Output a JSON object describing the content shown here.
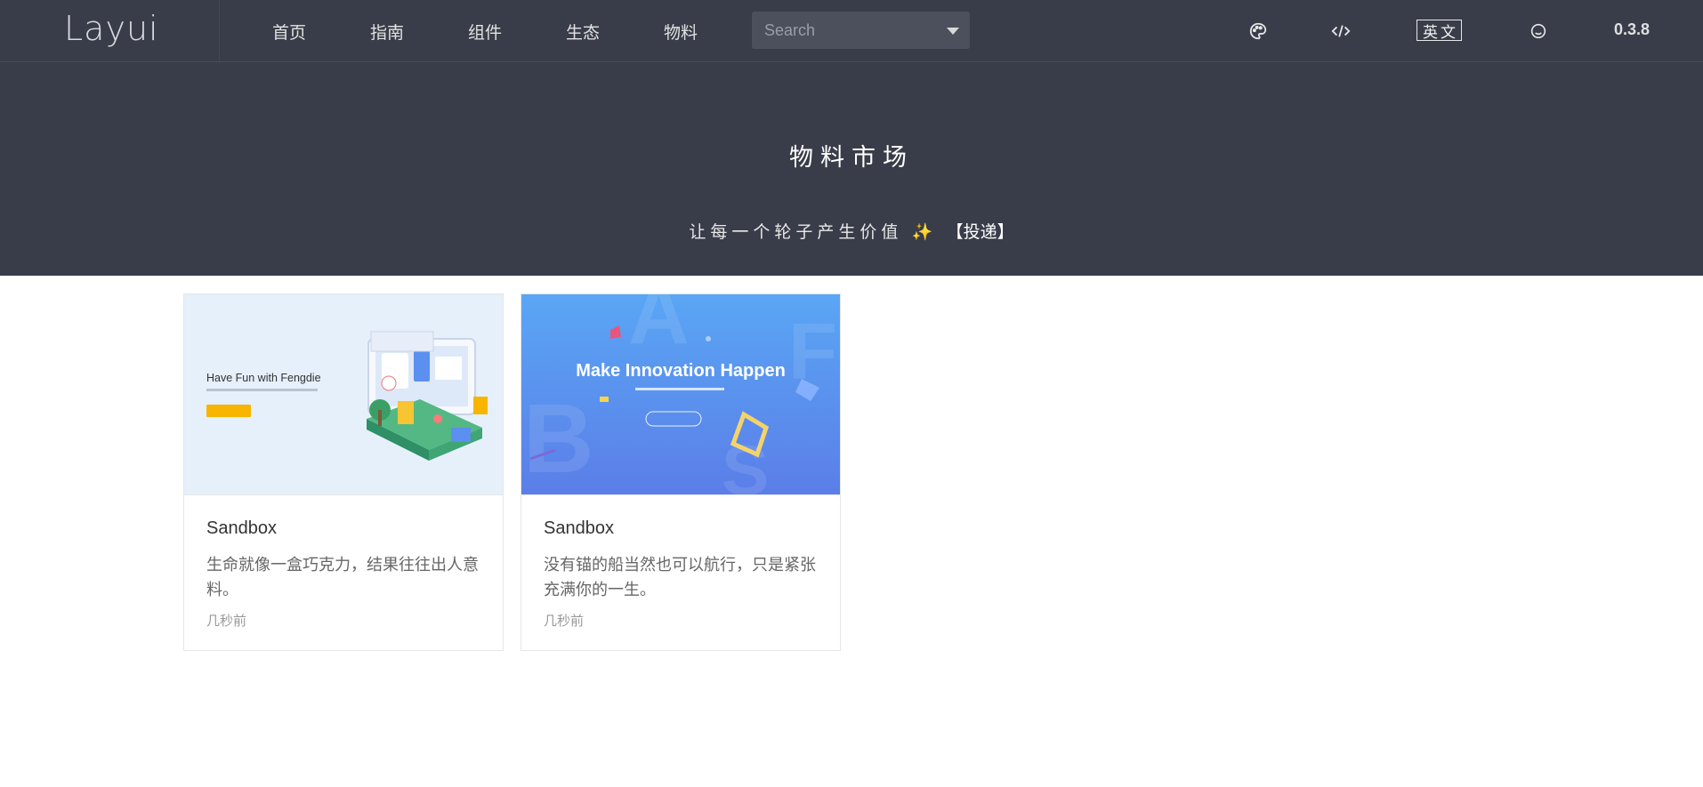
{
  "header": {
    "logo": "Layui",
    "nav": [
      "首页",
      "指南",
      "组件",
      "生态",
      "物料"
    ],
    "search": {
      "placeholder": "Search",
      "value": ""
    },
    "icons": [
      "palette-icon",
      "code-icon",
      "smile-icon"
    ],
    "lang_label": "英文",
    "version": "0.3.8"
  },
  "hero": {
    "title": "物料市场",
    "subtitle": "让每一个轮子产生价值",
    "sparkle": "✨",
    "link": "【投递】"
  },
  "cards": [
    {
      "banner_heading": "Have Fun with Fengdie",
      "title": "Sandbox",
      "desc": "生命就像一盒巧克力，结果往往出人意料。",
      "time": "几秒前"
    },
    {
      "banner_heading": "Make Innovation Happen",
      "title": "Sandbox",
      "desc": "没有锚的船当然也可以航行，只是紧张充满你的一生。",
      "time": "几秒前"
    }
  ],
  "colors": {
    "header_bg": "#393d49",
    "search_bg": "#4c505d",
    "page_bg": "#ffffff",
    "card_border": "#e6e6e6",
    "banner1_bg": "#e6f0fb",
    "banner2_bg": "#5b8ff0"
  }
}
